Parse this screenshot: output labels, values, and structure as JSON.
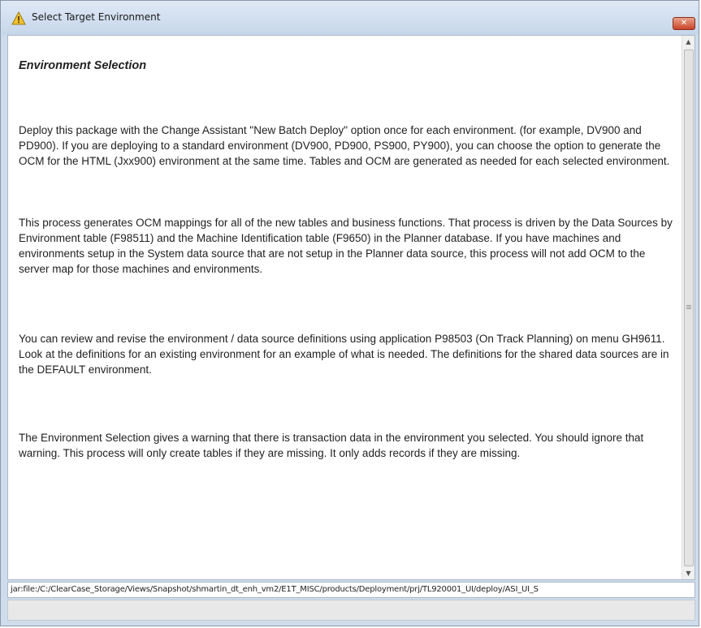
{
  "window": {
    "title": "Select Target Environment",
    "close_label": "✕",
    "title_icon": "warning-icon"
  },
  "content": {
    "heading": "Environment Selection",
    "paragraphs": [
      "Deploy this package with the Change Assistant \"New Batch Deploy\" option once for each environment. (for example, DV900 and PD900). If you are deploying to a standard environment (DV900, PD900, PS900, PY900), you can choose the option to generate the OCM for the HTML (Jxx900) environment at the same time. Tables and OCM are generated as needed for each selected environment.",
      "This process generates OCM mappings for all of the new tables and business functions. That process is driven by the Data Sources by Environment table (F98511) and the Machine Identification table (F9650) in the Planner database. If you have machines and environments setup in the System data source that are not setup in the Planner data source, this process will not add OCM to the server map for those machines and environments.",
      "You can review and revise the environment / data source definitions using application P98503 (On Track Planning) on menu GH9611. Look at the definitions for an existing environment for an example of what is needed. The definitions for the shared data sources are in the DEFAULT environment.",
      "The Environment Selection gives a warning that there is transaction data in the environment you selected. You should ignore that warning. This process will only create tables if they are missing. It only adds records if they are missing."
    ]
  },
  "scrollbar": {
    "up_arrow": "▲",
    "down_arrow": "▼"
  },
  "status": {
    "url": "jar:file:/C:/ClearCase_Storage/Views/Snapshot/shmartin_dt_enh_vm2/E1T_MISC/products/Deployment/prj/TL920001_UI/deploy/ASI_UI_S"
  },
  "colors": {
    "titlebar": "#c6d6ea",
    "close_button": "#c9442a",
    "warning_icon": "#f2c230"
  }
}
